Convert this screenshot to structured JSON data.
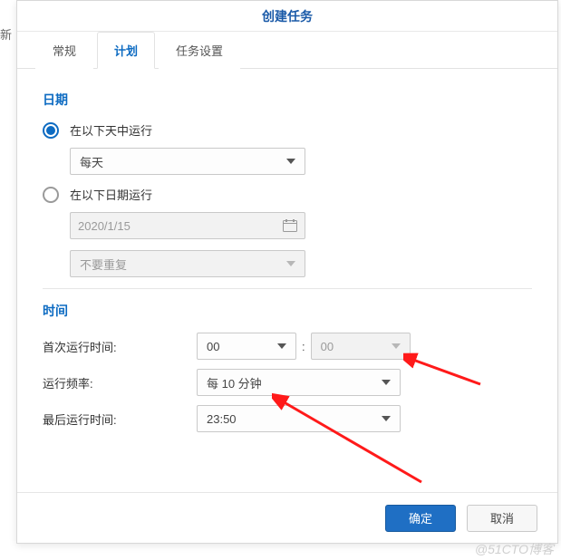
{
  "stray_text": "新",
  "dialog": {
    "title": "创建任务",
    "tabs": [
      {
        "label": "常规",
        "active": false
      },
      {
        "label": "计划",
        "active": true
      },
      {
        "label": "任务设置",
        "active": false
      }
    ]
  },
  "date_section": {
    "heading": "日期",
    "opt_days": {
      "label": "在以下天中运行",
      "checked": true,
      "selected": "每天"
    },
    "opt_date": {
      "label": "在以下日期运行",
      "checked": false,
      "date_value": "2020/1/15",
      "repeat_value": "不要重复"
    }
  },
  "time_section": {
    "heading": "时间",
    "first_run": {
      "label": "首次运行时间:",
      "hour": "00",
      "minute": "00"
    },
    "frequency": {
      "label": "运行频率:",
      "value": "每 10 分钟"
    },
    "last_run": {
      "label": "最后运行时间:",
      "value": "23:50"
    }
  },
  "footer": {
    "ok": "确定",
    "cancel": "取消"
  },
  "watermark": "@51CTO博客"
}
